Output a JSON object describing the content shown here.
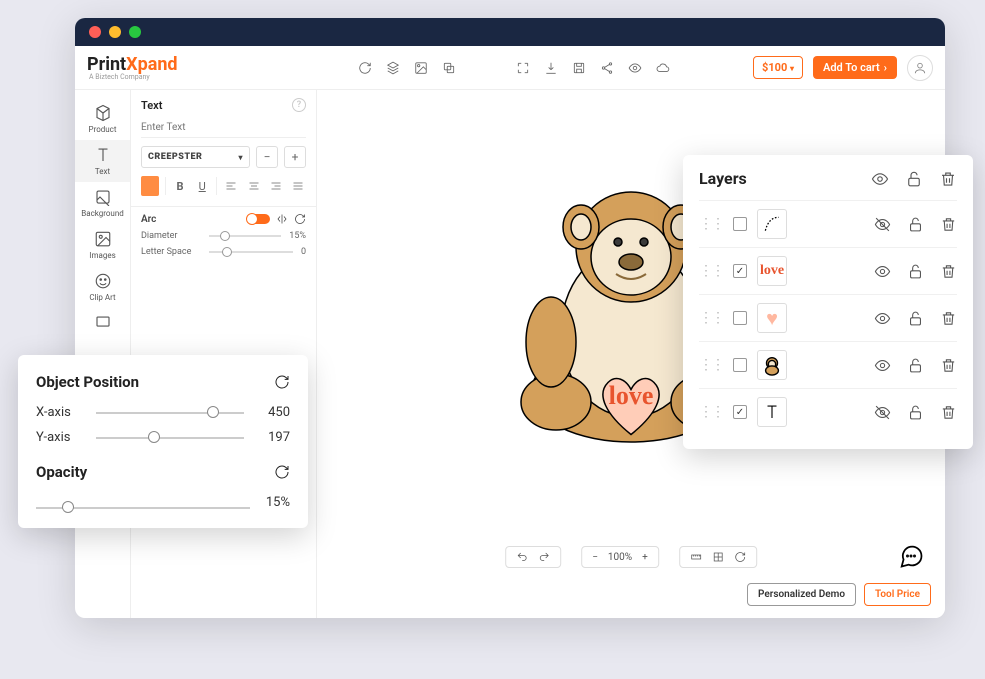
{
  "logo": {
    "part1": "Print",
    "part2": "Xpand",
    "sub": "A Biztech Company"
  },
  "price": "$100",
  "cart_label": "Add To cart",
  "sidebar": {
    "items": [
      {
        "label": "Product"
      },
      {
        "label": "Text"
      },
      {
        "label": "Background"
      },
      {
        "label": "Images"
      },
      {
        "label": "Clip Art"
      }
    ]
  },
  "text_panel": {
    "title": "Text",
    "placeholder": "Enter Text",
    "font": "CREEPSTER",
    "arc_label": "Arc",
    "diameter_label": "Diameter",
    "diameter_value": "15%",
    "letter_space_label": "Letter Space",
    "letter_space_value": "0"
  },
  "object_position": {
    "title": "Object Position",
    "x_label": "X-axis",
    "x_value": "450",
    "y_label": "Y-axis",
    "y_value": "197",
    "opacity_title": "Opacity",
    "opacity_value": "15%"
  },
  "layers": {
    "title": "Layers",
    "rows": [
      {
        "checked": false,
        "thumb": "line",
        "hidden": true
      },
      {
        "checked": true,
        "thumb": "love",
        "hidden": false
      },
      {
        "checked": false,
        "thumb": "heart",
        "hidden": false
      },
      {
        "checked": false,
        "thumb": "monkey",
        "hidden": false
      },
      {
        "checked": true,
        "thumb": "text",
        "hidden": true
      }
    ]
  },
  "zoom": "100%",
  "canvas_text": "love",
  "footer": {
    "demo": "Personalized Demo",
    "price": "Tool Price"
  }
}
